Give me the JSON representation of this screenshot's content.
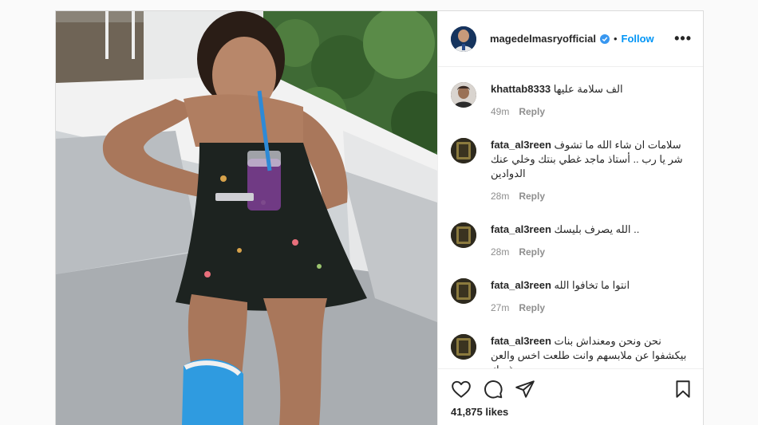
{
  "post": {
    "username": "magedelmasryofficial",
    "separator": "•",
    "follow_label": "Follow",
    "more_label": "•••",
    "likes": "41,875 likes"
  },
  "comments": [
    {
      "user": "khattab8333",
      "text": "الف سلامة عليها",
      "time": "49m",
      "reply": "Reply"
    },
    {
      "user": "fata_al3reen",
      "text": "سلامات ان شاء الله ما تشوف شر يا رب .. أستاذ ماجد غطي بنتك وخلي عنك الدوادين",
      "time": "28m",
      "reply": "Reply"
    },
    {
      "user": "fata_al3reen",
      "text": "الله يصرف بليسك ..",
      "time": "28m",
      "reply": "Reply"
    },
    {
      "user": "fata_al3reen",
      "text": "انتوا ما تخافوا الله",
      "time": "27m",
      "reply": "Reply"
    },
    {
      "user": "fata_al3reen",
      "text": "نحن ونحن ومعنداش بنات بيكشفوا عن ملابسهم وانت طلعت اخس والعن من غيرك",
      "time": "",
      "reply": ""
    }
  ],
  "icons": {
    "like": "heart-icon",
    "comment": "comment-icon",
    "share": "share-icon",
    "save": "bookmark-icon",
    "verified": "verified-badge-icon",
    "more": "more-options-icon"
  },
  "colors": {
    "accent": "#0095f6",
    "text": "#262626",
    "muted": "#8e8e8e",
    "verified": "#3897f0"
  }
}
